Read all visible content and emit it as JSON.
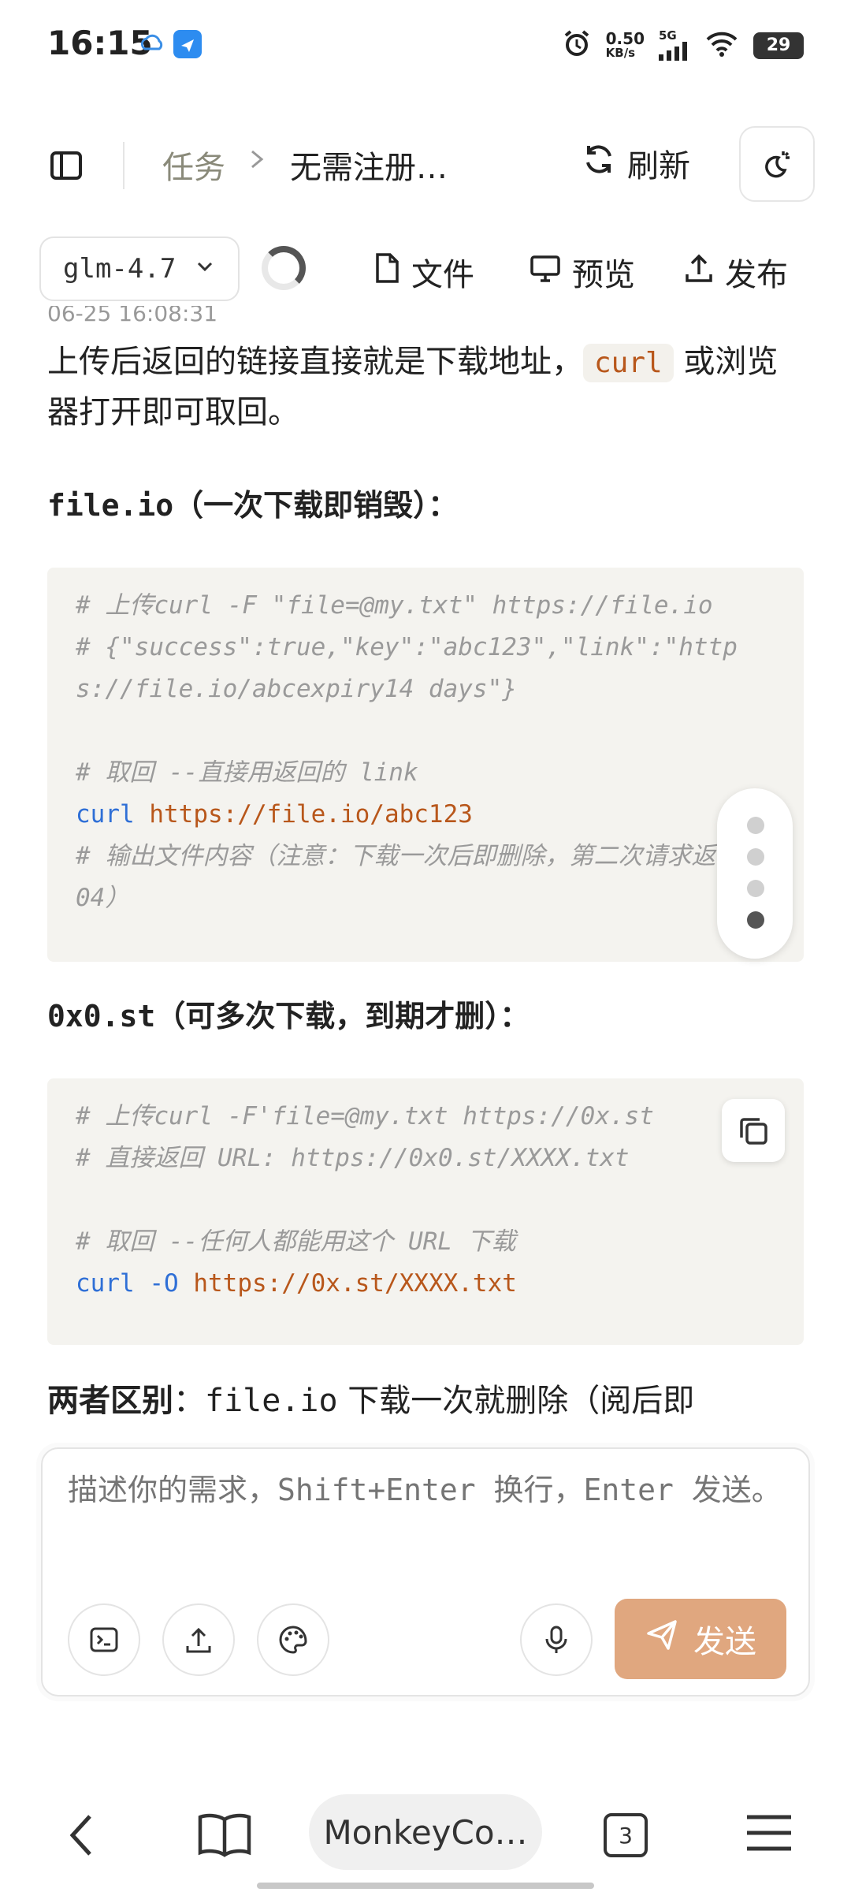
{
  "status_bar": {
    "time": "16:15",
    "net_speed_value": "0.50",
    "net_speed_unit": "KB/s",
    "network": "5G",
    "battery": "29"
  },
  "header": {
    "breadcrumb_tasks": "任务",
    "breadcrumb_current": "无需注册…",
    "refresh_label": "刷新"
  },
  "toolbar": {
    "model": "glm-4.7",
    "files_label": "文件",
    "preview_label": "预览",
    "publish_label": "发布"
  },
  "content": {
    "timestamp_clipped": "06-25 16:08:31",
    "para_before": "上传后返回的链接直接就是下载地址，",
    "para_code": "curl",
    "para_after": " 或浏览器打开即可取回。",
    "section1_title_code": "file.io",
    "section1_title_text": "（一次下载即销毁）：",
    "code1": {
      "line1": "# 上传curl -F \"file=@my.txt\" https://file.io",
      "line2": "# {\"success\":true,\"key\":\"abc123\",\"link\":\"https://file.io/abcexpiry14 days\"}",
      "line3": "# 取回 --直接用返回的 link",
      "line4_cmd": "curl",
      "line4_url": "https://file.io/abc123",
      "line5": "# 输出文件内容（注意：下载一次后即删除，第二次请求返回 404）"
    },
    "section2_title_code": "0x0.st",
    "section2_title_text": "（可多次下载，到期才删）：",
    "code2": {
      "line1": "# 上传curl -F'file=@my.txt https://0x.st",
      "line2": "# 直接返回 URL: https://0x0.st/XXXX.txt",
      "line3": "# 取回 --任何人都能用这个 URL 下载",
      "line4_cmd": "curl",
      "line4_flag": "-O",
      "line4_url": "https://0x.st/XXXX.txt"
    },
    "diff_label": "两者区别",
    "diff_colon": "：",
    "diff_code": "file.io",
    "diff_text": " 下载一次就删除（阅后即"
  },
  "composer": {
    "placeholder": "描述你的需求，Shift+Enter 换行，Enter 发送。",
    "send_label": "发送"
  },
  "browser_bar": {
    "url_text": "MonkeyCo…",
    "tab_count": "3"
  },
  "colors": {
    "send_button": "#e0a77f",
    "inline_code": "#b8571b",
    "keyword": "#2f6fd6",
    "code_bg": "#f4f3ef"
  }
}
